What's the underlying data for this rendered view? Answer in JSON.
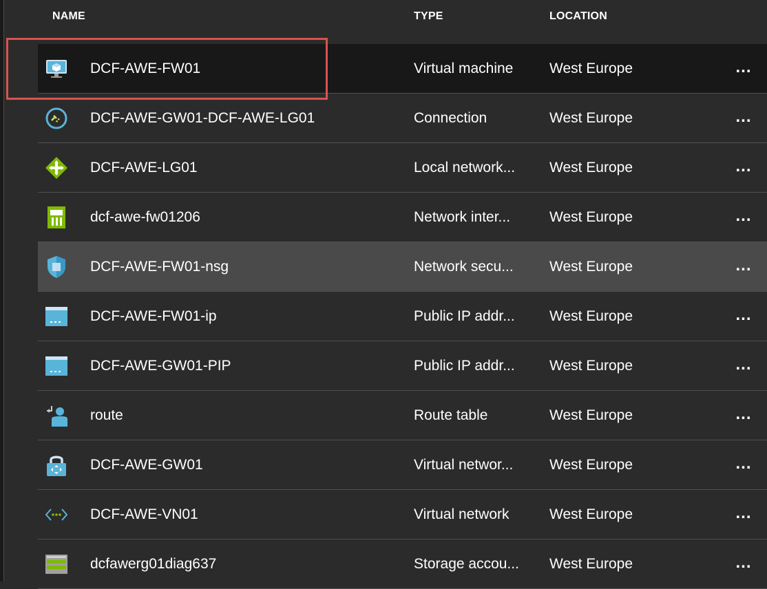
{
  "header": {
    "name": "NAME",
    "type": "TYPE",
    "location": "LOCATION"
  },
  "rows": [
    {
      "name": "DCF-AWE-FW01",
      "type": "Virtual machine",
      "location": "West Europe",
      "more": "...",
      "icon": "virtual-machine-icon"
    },
    {
      "name": "DCF-AWE-GW01-DCF-AWE-LG01",
      "type": "Connection",
      "location": "West Europe",
      "more": "...",
      "icon": "connection-icon"
    },
    {
      "name": "DCF-AWE-LG01",
      "type": "Local network...",
      "location": "West Europe",
      "more": "...",
      "icon": "local-network-gateway-icon"
    },
    {
      "name": "dcf-awe-fw01206",
      "type": "Network inter...",
      "location": "West Europe",
      "more": "...",
      "icon": "network-interface-icon"
    },
    {
      "name": "DCF-AWE-FW01-nsg",
      "type": "Network secu...",
      "location": "West Europe",
      "more": "...",
      "icon": "shield-icon"
    },
    {
      "name": "DCF-AWE-FW01-ip",
      "type": "Public IP addr...",
      "location": "West Europe",
      "more": "...",
      "icon": "public-ip-icon"
    },
    {
      "name": "DCF-AWE-GW01-PIP",
      "type": "Public IP addr...",
      "location": "West Europe",
      "more": "...",
      "icon": "public-ip-icon"
    },
    {
      "name": "route",
      "type": "Route table",
      "location": "West Europe",
      "more": "...",
      "icon": "route-table-icon"
    },
    {
      "name": "DCF-AWE-GW01",
      "type": "Virtual networ...",
      "location": "West Europe",
      "more": "...",
      "icon": "vpn-gateway-lock-icon"
    },
    {
      "name": "DCF-AWE-VN01",
      "type": "Virtual network",
      "location": "West Europe",
      "more": "...",
      "icon": "virtual-network-icon"
    },
    {
      "name": "dcfawerg01diag637",
      "type": "Storage accou...",
      "location": "West Europe",
      "more": "...",
      "icon": "storage-account-icon"
    }
  ],
  "colors": {
    "highlight": "#d9534f",
    "selected_row": "#181818",
    "hover_row": "#4a4a4a",
    "background": "#2b2b2b"
  }
}
